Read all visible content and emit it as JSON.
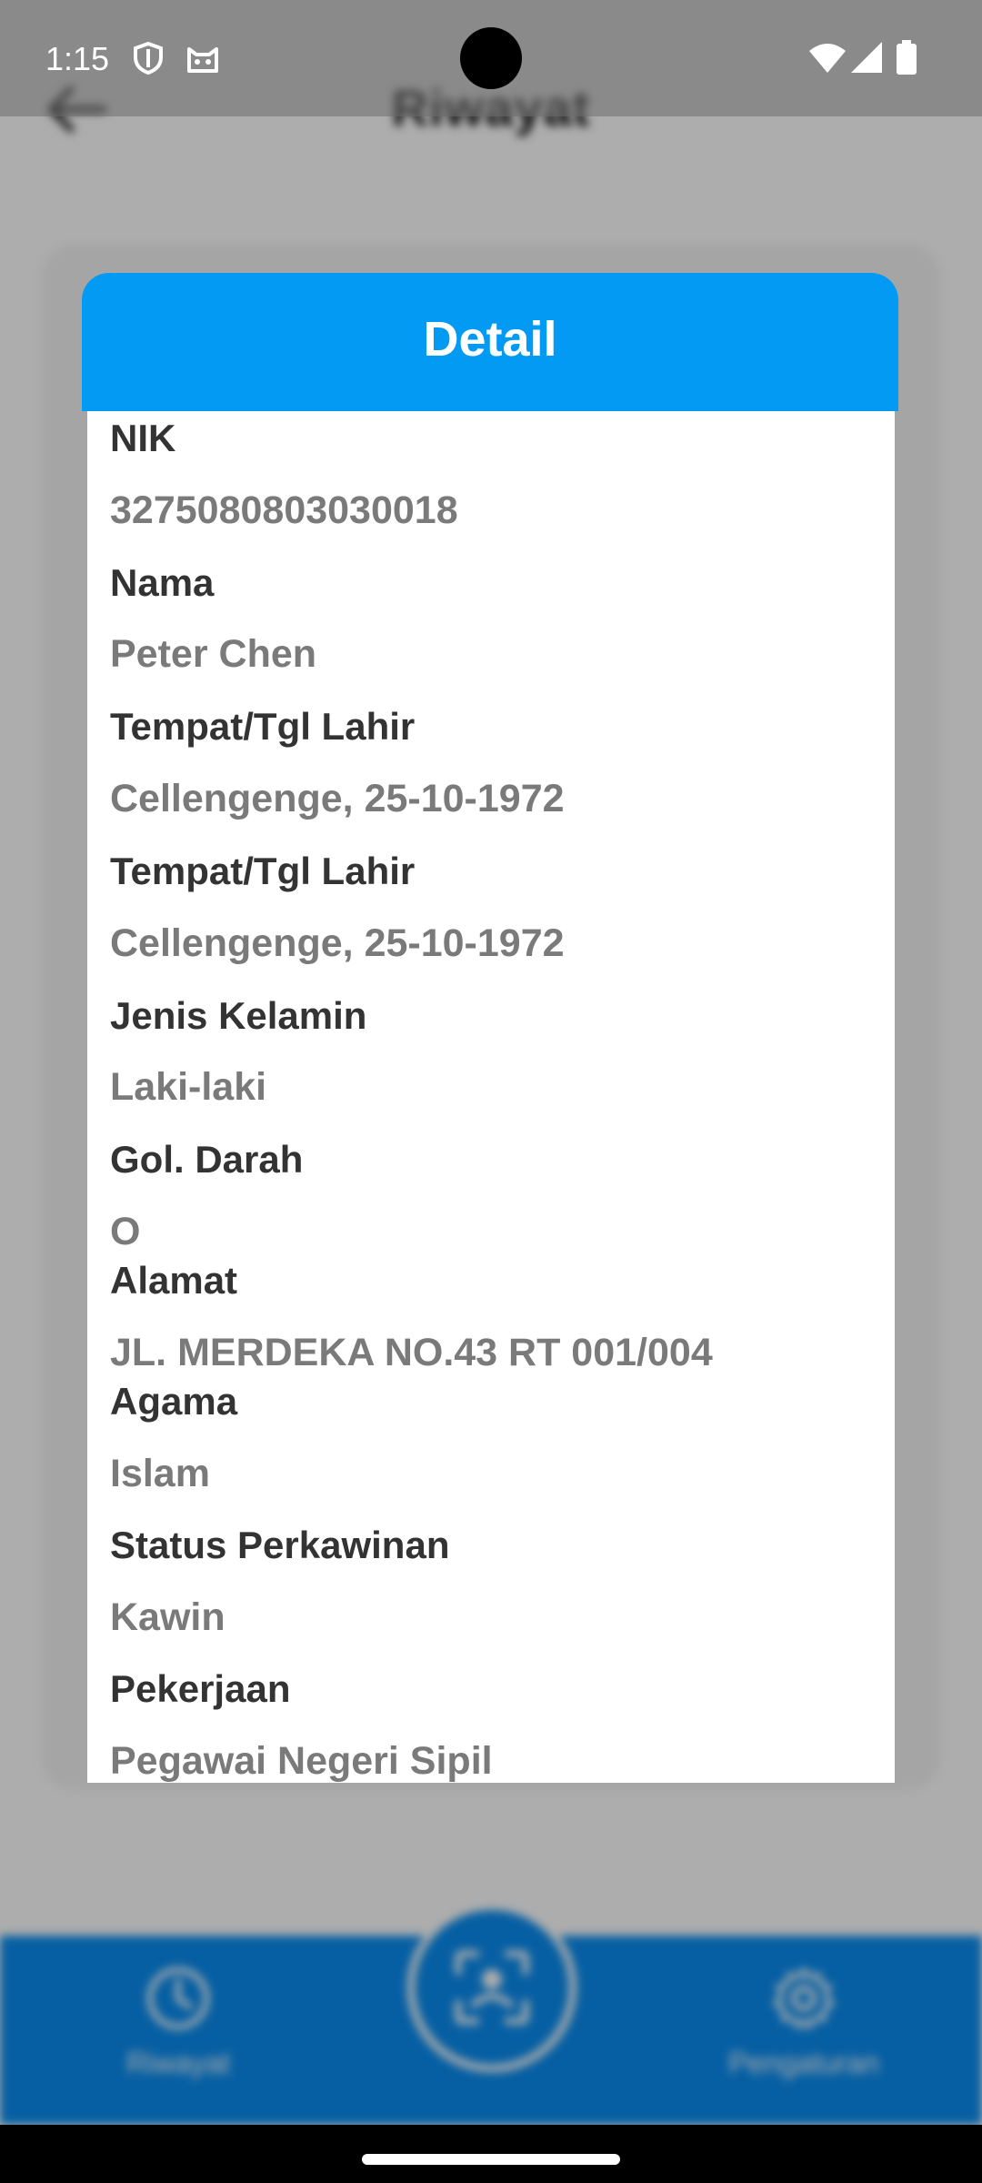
{
  "status_bar": {
    "time": "1:15",
    "icons": [
      "shield-icon",
      "cat-icon",
      "wifi-icon",
      "signal-icon",
      "battery-icon"
    ]
  },
  "app": {
    "title": "Riwayat",
    "back_icon": "arrow-left-icon",
    "bottom_nav": {
      "history_label": "Riwayat",
      "history_icon": "clock-icon",
      "scan_icon": "face-scan-icon",
      "settings_label": "Pengaturan",
      "settings_icon": "gear-icon"
    }
  },
  "dialog": {
    "title": "Detail",
    "fields": [
      {
        "label": "NIK",
        "value": "3275080803030018"
      },
      {
        "label": "Nama",
        "value": "Peter Chen"
      },
      {
        "label": "Tempat/Tgl Lahir",
        "value": "Cellengenge, 25-10-1972"
      },
      {
        "label": "Tempat/Tgl Lahir",
        "value": "Cellengenge, 25-10-1972"
      },
      {
        "label": "Jenis Kelamin",
        "value": "Laki-laki"
      },
      {
        "label": "Gol. Darah",
        "value": "O"
      },
      {
        "label": "Alamat",
        "value": "JL. MERDEKA NO.43 RT 001/004"
      },
      {
        "label": "Agama",
        "value": "Islam"
      },
      {
        "label": "Status Perkawinan",
        "value": "Kawin"
      },
      {
        "label": "Pekerjaan",
        "value": "Pegawai Negeri Sipil"
      }
    ]
  },
  "colors": {
    "dialog_header": "#039af3",
    "bottom_nav": "#0a8df0",
    "label_text": "#333333",
    "value_text": "#7a7a7a"
  }
}
